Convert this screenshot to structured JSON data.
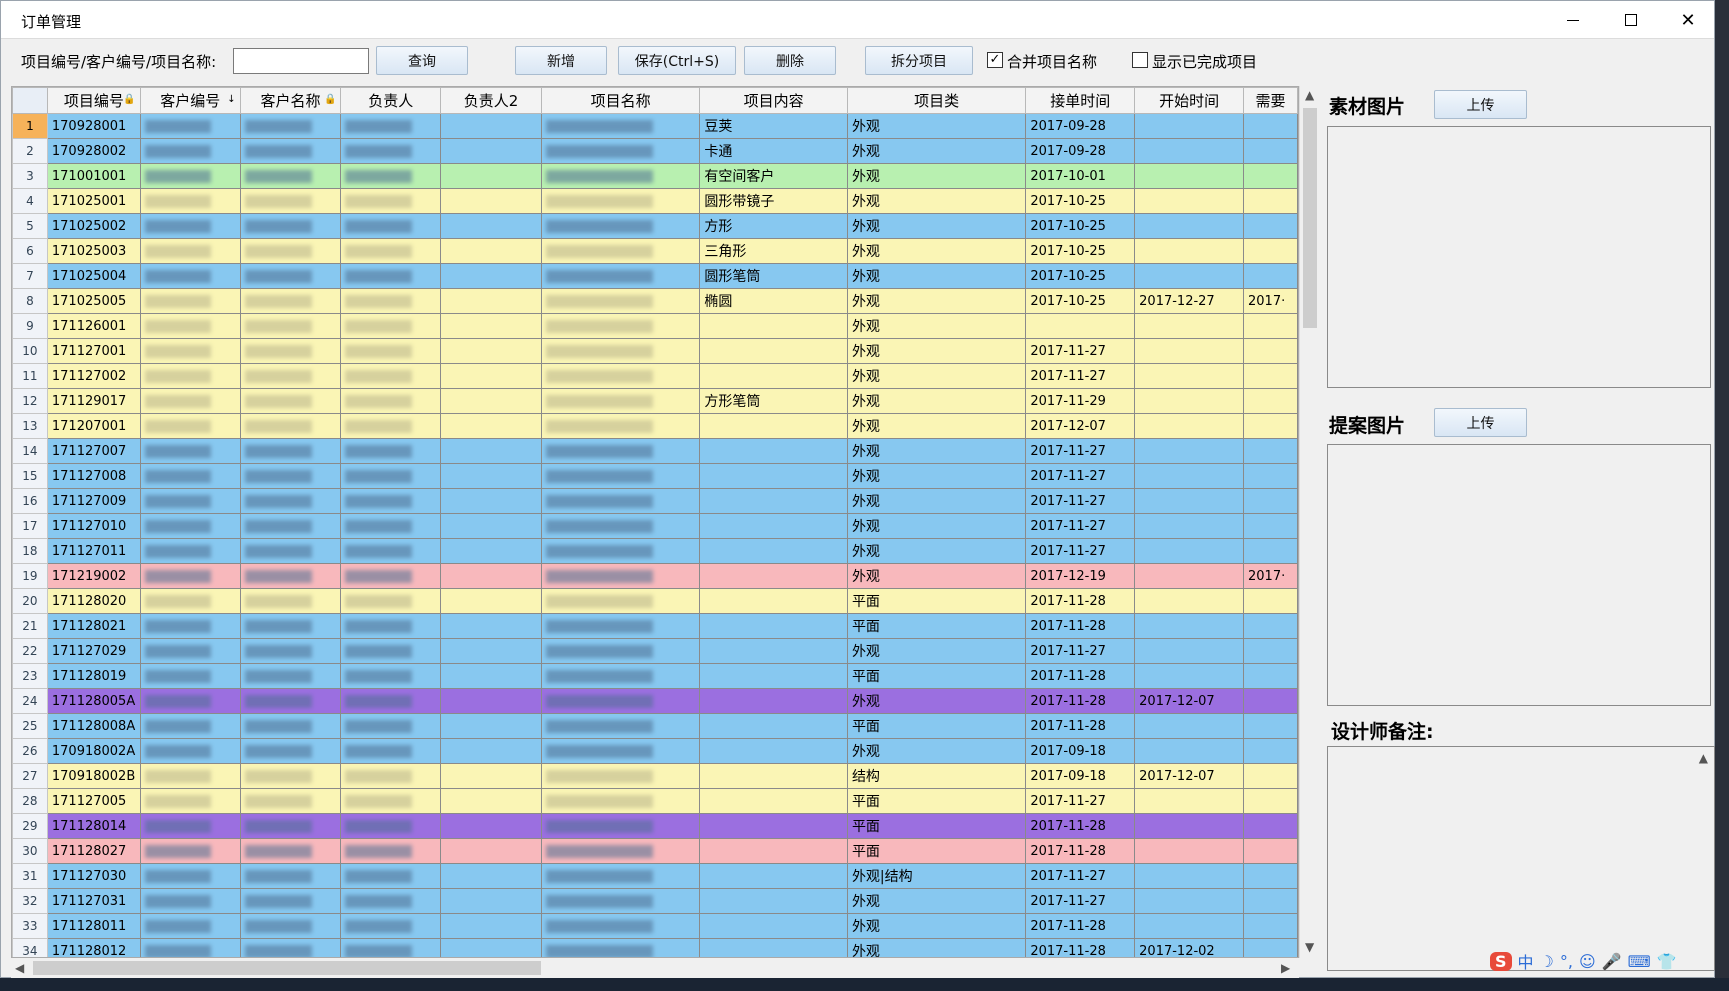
{
  "window": {
    "title": "订单管理"
  },
  "toolbar": {
    "search_label": "项目编号/客户编号/项目名称:",
    "search_value": "",
    "query": "查询",
    "add": "新增",
    "save": "保存(Ctrl+S)",
    "delete": "删除",
    "split": "拆分项目",
    "merge_label": "合并项目名称",
    "merge_checked": "✓",
    "show_done_label": "显示已完成项目"
  },
  "grid": {
    "columns": [
      "项目编号",
      "客户编号",
      "客户名称",
      "负责人",
      "负责人2",
      "项目名称",
      "项目内容",
      "项目类",
      "接单时间",
      "开始时间",
      "需要"
    ],
    "rows": [
      {
        "n": "1",
        "id": "170928001",
        "content": "豆荚",
        "type": "外观",
        "recv": "2017-09-28",
        "start": "",
        "need": "",
        "bg": "#87c8f0",
        "cur": true
      },
      {
        "n": "2",
        "id": "170928002",
        "content": "卡通",
        "type": "外观",
        "recv": "2017-09-28",
        "start": "",
        "need": "",
        "bg": "#87c8f0"
      },
      {
        "n": "3",
        "id": "171001001",
        "content": "有空间客户",
        "type": "外观",
        "recv": "2017-10-01",
        "start": "",
        "need": "",
        "bg": "#b8f0b0"
      },
      {
        "n": "4",
        "id": "171025001",
        "content": "圆形带镜子",
        "type": "外观",
        "recv": "2017-10-25",
        "start": "",
        "need": "",
        "bg": "#faf5b5"
      },
      {
        "n": "5",
        "id": "171025002",
        "content": "方形",
        "type": "外观",
        "recv": "2017-10-25",
        "start": "",
        "need": "",
        "bg": "#87c8f0"
      },
      {
        "n": "6",
        "id": "171025003",
        "content": "三角形",
        "type": "外观",
        "recv": "2017-10-25",
        "start": "",
        "need": "",
        "bg": "#faf5b5"
      },
      {
        "n": "7",
        "id": "171025004",
        "content": "圆形笔筒",
        "type": "外观",
        "recv": "2017-10-25",
        "start": "",
        "need": "",
        "bg": "#87c8f0"
      },
      {
        "n": "8",
        "id": "171025005",
        "content": "椭圆",
        "type": "外观",
        "recv": "2017-10-25",
        "start": "2017-12-27",
        "need": "2017·",
        "bg": "#faf5b5"
      },
      {
        "n": "9",
        "id": "171126001",
        "content": "",
        "type": "外观",
        "recv": "",
        "start": "",
        "need": "",
        "bg": "#faf5b5"
      },
      {
        "n": "10",
        "id": "171127001",
        "content": "",
        "type": "外观",
        "recv": "2017-11-27",
        "start": "",
        "need": "",
        "bg": "#faf5b5"
      },
      {
        "n": "11",
        "id": "171127002",
        "content": "",
        "type": "外观",
        "recv": "2017-11-27",
        "start": "",
        "need": "",
        "bg": "#faf5b5"
      },
      {
        "n": "12",
        "id": "171129017",
        "content": "方形笔筒",
        "type": "外观",
        "recv": "2017-11-29",
        "start": "",
        "need": "",
        "bg": "#faf5b5"
      },
      {
        "n": "13",
        "id": "171207001",
        "content": "",
        "type": "外观",
        "recv": "2017-12-07",
        "start": "",
        "need": "",
        "bg": "#faf5b5"
      },
      {
        "n": "14",
        "id": "171127007",
        "content": "",
        "type": "外观",
        "recv": "2017-11-27",
        "start": "",
        "need": "",
        "bg": "#87c8f0"
      },
      {
        "n": "15",
        "id": "171127008",
        "content": "",
        "type": "外观",
        "recv": "2017-11-27",
        "start": "",
        "need": "",
        "bg": "#87c8f0"
      },
      {
        "n": "16",
        "id": "171127009",
        "content": "",
        "type": "外观",
        "recv": "2017-11-27",
        "start": "",
        "need": "",
        "bg": "#87c8f0"
      },
      {
        "n": "17",
        "id": "171127010",
        "content": "",
        "type": "外观",
        "recv": "2017-11-27",
        "start": "",
        "need": "",
        "bg": "#87c8f0"
      },
      {
        "n": "18",
        "id": "171127011",
        "content": "",
        "type": "外观",
        "recv": "2017-11-27",
        "start": "",
        "need": "",
        "bg": "#87c8f0"
      },
      {
        "n": "19",
        "id": "171219002",
        "content": "",
        "type": "外观",
        "recv": "2017-12-19",
        "start": "",
        "need": "2017·",
        "bg": "#f8b8bc"
      },
      {
        "n": "20",
        "id": "171128020",
        "content": "",
        "type": "平面",
        "recv": "2017-11-28",
        "start": "",
        "need": "",
        "bg": "#faf5b5"
      },
      {
        "n": "21",
        "id": "171128021",
        "content": "",
        "type": "平面",
        "recv": "2017-11-28",
        "start": "",
        "need": "",
        "bg": "#87c8f0"
      },
      {
        "n": "22",
        "id": "171127029",
        "content": "",
        "type": "外观",
        "recv": "2017-11-27",
        "start": "",
        "need": "",
        "bg": "#87c8f0"
      },
      {
        "n": "23",
        "id": "171128019",
        "content": "",
        "type": "平面",
        "recv": "2017-11-28",
        "start": "",
        "need": "",
        "bg": "#87c8f0"
      },
      {
        "n": "24",
        "id": "171128005A",
        "content": "",
        "type": "外观",
        "recv": "2017-11-28",
        "start": "2017-12-07",
        "need": "",
        "bg": "#9b6fe0"
      },
      {
        "n": "25",
        "id": "171128008A",
        "content": "",
        "type": "平面",
        "recv": "2017-11-28",
        "start": "",
        "need": "",
        "bg": "#87c8f0"
      },
      {
        "n": "26",
        "id": "170918002A",
        "content": "",
        "type": "外观",
        "recv": "2017-09-18",
        "start": "",
        "need": "",
        "bg": "#87c8f0"
      },
      {
        "n": "27",
        "id": "170918002B",
        "content": "",
        "type": "结构",
        "recv": "2017-09-18",
        "start": "2017-12-07",
        "need": "",
        "bg": "#faf5b5"
      },
      {
        "n": "28",
        "id": "171127005",
        "content": "",
        "type": "平面",
        "recv": "2017-11-27",
        "start": "",
        "need": "",
        "bg": "#faf5b5"
      },
      {
        "n": "29",
        "id": "171128014",
        "content": "",
        "type": "平面",
        "recv": "2017-11-28",
        "start": "",
        "need": "",
        "bg": "#9b6fe0"
      },
      {
        "n": "30",
        "id": "171128027",
        "content": "",
        "type": "平面",
        "recv": "2017-11-28",
        "start": "",
        "need": "",
        "bg": "#f8b8bc"
      },
      {
        "n": "31",
        "id": "171127030",
        "content": "",
        "type": "外观|结构",
        "recv": "2017-11-27",
        "start": "",
        "need": "",
        "bg": "#87c8f0"
      },
      {
        "n": "32",
        "id": "171127031",
        "content": "",
        "type": "外观",
        "recv": "2017-11-27",
        "start": "",
        "need": "",
        "bg": "#87c8f0"
      },
      {
        "n": "33",
        "id": "171128011",
        "content": "",
        "type": "外观",
        "recv": "2017-11-28",
        "start": "",
        "need": "",
        "bg": "#87c8f0"
      },
      {
        "n": "34",
        "id": "171128012",
        "content": "",
        "type": "外观",
        "recv": "2017-11-28",
        "start": "2017-12-02",
        "need": "",
        "bg": "#87c8f0"
      }
    ]
  },
  "panel": {
    "material_title": "素材图片",
    "upload1": "上传",
    "proposal_title": "提案图片",
    "upload2": "上传",
    "designer_note_title": "设计师备注:"
  },
  "ime": {
    "logo": "S",
    "items": [
      "中",
      "☽",
      "°,",
      "☺",
      "🎤",
      "⌨",
      "👕"
    ]
  }
}
